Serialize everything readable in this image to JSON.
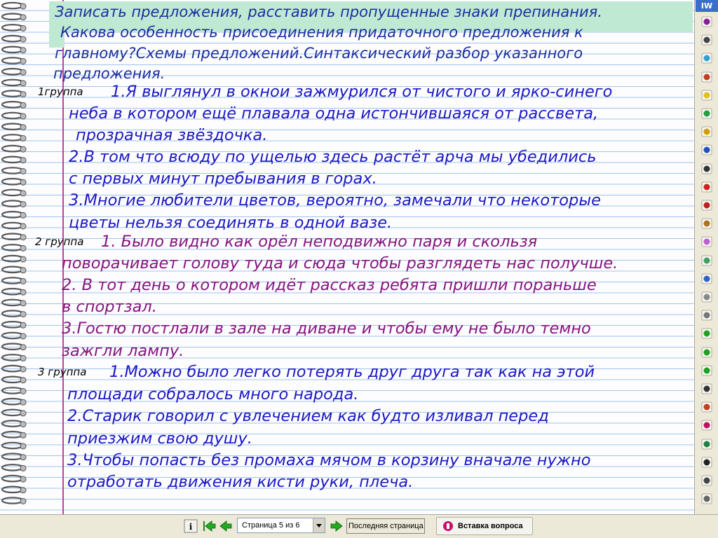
{
  "page": {
    "header_lines": [
      "Записать предложения, расставить пропущенные знаки препинания.",
      "Какова особенность присоединения придаточного предложения к",
      "главному?Схемы предложений.Синтаксический разбор указанного",
      "предложения."
    ],
    "groups": [
      {
        "label": "1группа",
        "color": "#1c19c4",
        "lines": [
          "1.Я выглянул в окнои зажмурился от чистого и ярко-синего",
          "неба в котором ещё плавала одна истончившаяся от рассвета,",
          "прозрачная звёздочка.",
          "2.В том что всюду по ущелью здесь растёт арча мы убедились",
          "с первых минут пребывания в горах.",
          "3.Многие любители цветов, вероятно, замечали что некоторые",
          "цветы нельзя соединять в одной вазе."
        ]
      },
      {
        "label": "2 группа",
        "color": "#86157f",
        "lines": [
          "1. Было видно как орёл неподвижно паря и скользя",
          "поворачивает голову туда и сюда чтобы разглядеть нас получше.",
          "2. В тот день о котором идёт рассказ ребята пришли пораньше",
          "в спортзал.",
          "3.Гостю постлали в зале на диване и чтобы ему не было темно",
          "зажгли лампу."
        ]
      },
      {
        "label": "3 группа",
        "color": "#1c19c4",
        "lines": [
          "1.Можно было легко потерять друг друга так как на этой",
          "площади собралось много народа.",
          "2.Старик говорил с увлечением как будто изливал перед",
          "приезжим свою душу.",
          "3.Чтобы попасть без промаха мячом в корзину вначале нужно",
          "отработать движения кисти руки, плеча."
        ]
      }
    ]
  },
  "toolbar": {
    "header_label": "IW",
    "tools": [
      "pen-icon",
      "mouse-icon",
      "color-picker-icon",
      "line-width-icon",
      "highlighter-icon",
      "magic-pen-icon",
      "pencil-icon",
      "fill-icon",
      "pointer-icon",
      "undo-icon",
      "delete-icon",
      "stamp-icon",
      "wand-icon",
      "capture-icon",
      "zoom-icon",
      "blank-page-icon",
      "grid-page-icon",
      "reveal-icon",
      "back-arrow-icon",
      "forward-arrow-icon",
      "page-sorter-icon",
      "toolbox-icon",
      "info-icon",
      "marker-icon",
      "text-icon",
      "keyboard-icon",
      "more-icon"
    ]
  },
  "bottombar": {
    "page_select_value": "Страница 5 из 6",
    "last_page_label": "Последняя страница",
    "insert_question_label": "Вставка вопроса"
  },
  "colors": {
    "header_bg": "#bfe9d3",
    "header_text": "#1a2fa0",
    "blue_text": "#1c19c4",
    "purple_text": "#86157f",
    "ruled_line": "#9fc3ea",
    "margin_line": "#c23fa0"
  }
}
